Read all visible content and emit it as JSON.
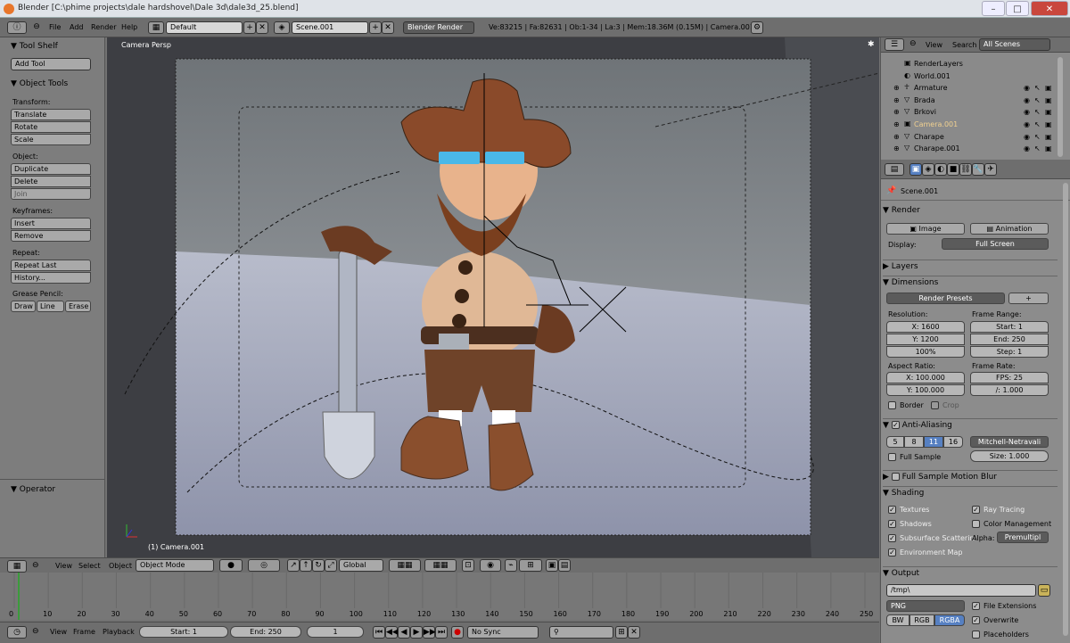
{
  "titlebar": {
    "title": "Blender [C:\\phime projects\\dale hardshovel\\Dale 3d\\dale3d_25.blend]",
    "minimize": "–",
    "maximize": "□",
    "close": "✕"
  },
  "topbar": {
    "menus": [
      "File",
      "Add",
      "Render",
      "Help"
    ],
    "screen": "Default",
    "scene": "Scene.001",
    "engine": "Blender Render",
    "stats": "Ve:83215 | Fa:82631 | Ob:1-34 | La:3 | Mem:18.36M (0.15M) | Camera.001"
  },
  "toolshelf": {
    "title": "Tool Shelf",
    "add_tool": "Add Tool",
    "object_tools": "Object Tools",
    "transform_label": "Transform:",
    "transform": [
      "Translate",
      "Rotate",
      "Scale"
    ],
    "object_label": "Object:",
    "object": [
      "Duplicate",
      "Delete",
      "Join"
    ],
    "keyframes_label": "Keyframes:",
    "keyframes": [
      "Insert",
      "Remove"
    ],
    "repeat_label": "Repeat:",
    "repeat": [
      "Repeat Last",
      "History..."
    ],
    "grease_label": "Grease Pencil:",
    "grease": [
      "Draw",
      "Line",
      "Erase"
    ],
    "operator": "Operator"
  },
  "viewport": {
    "view_name": "Camera Persp",
    "object_name": "(1) Camera.001"
  },
  "viewport_header": {
    "menus": [
      "View",
      "Select",
      "Object"
    ],
    "mode": "Object Mode",
    "orientation": "Global"
  },
  "timeline": {
    "ticks": [
      "0",
      "10",
      "20",
      "30",
      "40",
      "50",
      "60",
      "70",
      "80",
      "90",
      "100",
      "110",
      "120",
      "130",
      "140",
      "150",
      "160",
      "170",
      "180",
      "190",
      "200",
      "210",
      "220",
      "230",
      "240",
      "250"
    ],
    "menus": [
      "View",
      "Frame",
      "Playback"
    ],
    "start": "Start: 1",
    "end": "End: 250",
    "current": "1",
    "sync": "No Sync"
  },
  "outliner": {
    "menus": [
      "View",
      "Search"
    ],
    "filter": "All Scenes",
    "items": [
      "RenderLayers",
      "World.001",
      "Armature",
      "Brada",
      "Brkovi",
      "Camera.001",
      "Charape",
      "Charape.001"
    ]
  },
  "properties": {
    "scene": "Scene.001",
    "render_title": "Render",
    "image_btn": "Image",
    "animation_btn": "Animation",
    "display_label": "Display:",
    "display_value": "Full Screen",
    "layers": "Layers",
    "dimensions": "Dimensions",
    "render_presets": "Render Presets",
    "resolution_label": "Resolution:",
    "res_x": "X: 1600",
    "res_y": "Y: 1200",
    "res_pct": "100%",
    "frame_range_label": "Frame Range:",
    "start": "Start: 1",
    "end": "End: 250",
    "step": "Step: 1",
    "aspect_label": "Aspect Ratio:",
    "aspect_x": "X: 100.000",
    "aspect_y": "Y: 100.000",
    "frame_rate_label": "Frame Rate:",
    "fps": "FPS: 25",
    "fps_base": "/: 1.000",
    "border": "Border",
    "crop": "Crop",
    "aa_title": "Anti-Aliasing",
    "aa_samples": [
      "5",
      "8",
      "11",
      "16"
    ],
    "aa_filter": "Mitchell-Netravali",
    "full_sample": "Full Sample",
    "aa_size": "Size: 1.000",
    "motion_blur": "Full Sample Motion Blur",
    "shading_title": "Shading",
    "textures": "Textures",
    "ray_tracing": "Ray Tracing",
    "shadows": "Shadows",
    "color_mgmt": "Color Management",
    "sss": "Subsurface Scatterin",
    "alpha_label": "Alpha:",
    "alpha_value": "Premultipl",
    "env_map": "Environment Map",
    "output_title": "Output",
    "output_path": "/tmp\\",
    "format": "PNG",
    "file_ext": "File Extensions",
    "bw": "BW",
    "rgb": "RGB",
    "rgba": "RGBA",
    "overwrite": "Overwrite",
    "placeholders": "Placeholders"
  },
  "colors": {
    "accent": "#5680c2",
    "panel": "#8c8c8c",
    "viewport_bg": "#3d3e43"
  }
}
